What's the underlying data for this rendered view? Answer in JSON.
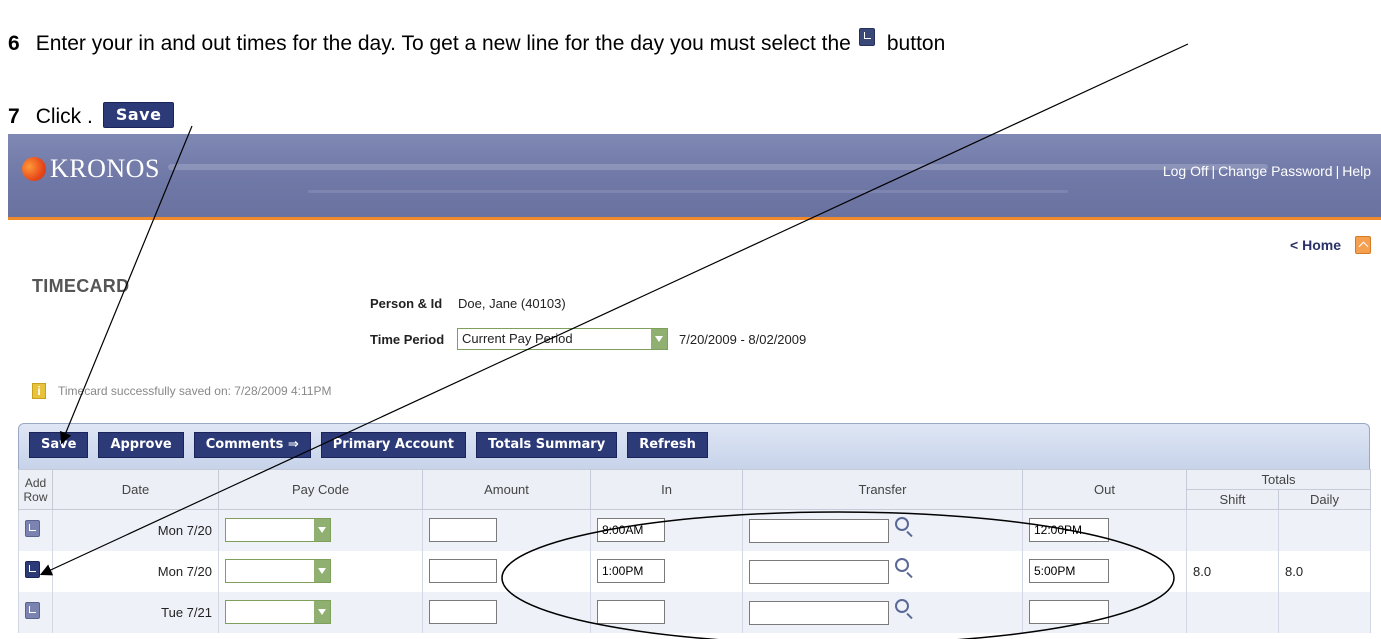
{
  "instructions": {
    "step6": {
      "number": "6",
      "text": "Enter your in and out times for the day. To get a new line for the day you must select the",
      "after_text": "button"
    },
    "step7": {
      "number": "7",
      "text": "Click .",
      "save_label": "Save"
    }
  },
  "header": {
    "logo_text": "KRONOS",
    "links": [
      "Log Off",
      "Change Password",
      "Help"
    ]
  },
  "nav": {
    "home_label": "< Home"
  },
  "page": {
    "title": "TIMECARD",
    "person_label": "Person & Id",
    "person_value": "Doe, Jane (40103)",
    "time_period_label": "Time Period",
    "time_period_selected": "Current Pay Period",
    "time_period_range": "7/20/2009 - 8/02/2009",
    "info_message": "Timecard successfully saved on: 7/28/2009 4:11PM"
  },
  "toolbar": {
    "buttons": [
      "Save",
      "Approve",
      "Comments ⇒",
      "Primary Account",
      "Totals Summary",
      "Refresh"
    ]
  },
  "grid": {
    "headers": {
      "add_row": "Add Row",
      "date": "Date",
      "pay_code": "Pay Code",
      "amount": "Amount",
      "in": "In",
      "transfer": "Transfer",
      "out": "Out",
      "totals": "Totals",
      "shift": "Shift",
      "daily": "Daily"
    },
    "rows": [
      {
        "date": "Mon 7/20",
        "pay_code": "",
        "amount": "",
        "in": "8:00AM",
        "transfer": "",
        "out": "12:00PM",
        "shift": "",
        "daily": ""
      },
      {
        "date": "Mon 7/20",
        "pay_code": "",
        "amount": "",
        "in": "1:00PM",
        "transfer": "",
        "out": "5:00PM",
        "shift": "8.0",
        "daily": "8.0"
      },
      {
        "date": "Tue 7/21",
        "pay_code": "",
        "amount": "",
        "in": "",
        "transfer": "",
        "out": "",
        "shift": "",
        "daily": ""
      }
    ]
  },
  "colors": {
    "header_bg": "#7079a6",
    "header_accent": "#f08a2a",
    "button_bg": "#2d3a78",
    "select_arrow": "#8fb070"
  }
}
